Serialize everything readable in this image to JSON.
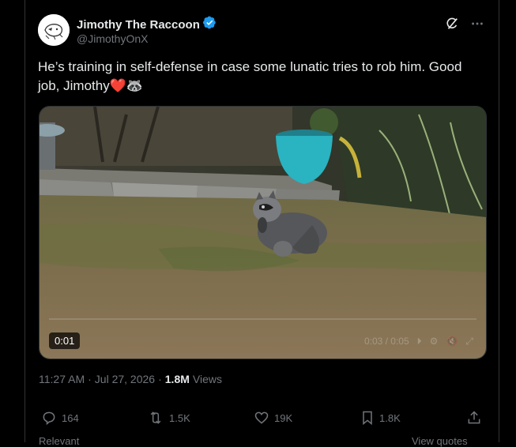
{
  "author": {
    "name": "Jimothy The Raccoon",
    "handle": "@JimothyOnX",
    "verified": true
  },
  "tweet": {
    "text": "He’s training in self-defense in case some lunatic tries to rob him. Good job, Jimothy",
    "emoji": "❤️🦝"
  },
  "media": {
    "timecode": "0:01",
    "faint_overlay": "0:03 / 0:05"
  },
  "meta": {
    "time": "11:27 AM",
    "sep1": "·",
    "date": "Jul 27, 2026",
    "sep2": "·",
    "views_count": "1.8M",
    "views_label": "Views"
  },
  "actions": {
    "replies": "164",
    "reposts": "1.5K",
    "likes": "19K",
    "bookmarks": "1.8K"
  },
  "below": {
    "left": "Relevant",
    "right": "View quotes"
  },
  "colors": {
    "verified": "#1d9bf0",
    "muted": "#71767b",
    "text": "#e7e9ea",
    "border": "#2f3336"
  }
}
